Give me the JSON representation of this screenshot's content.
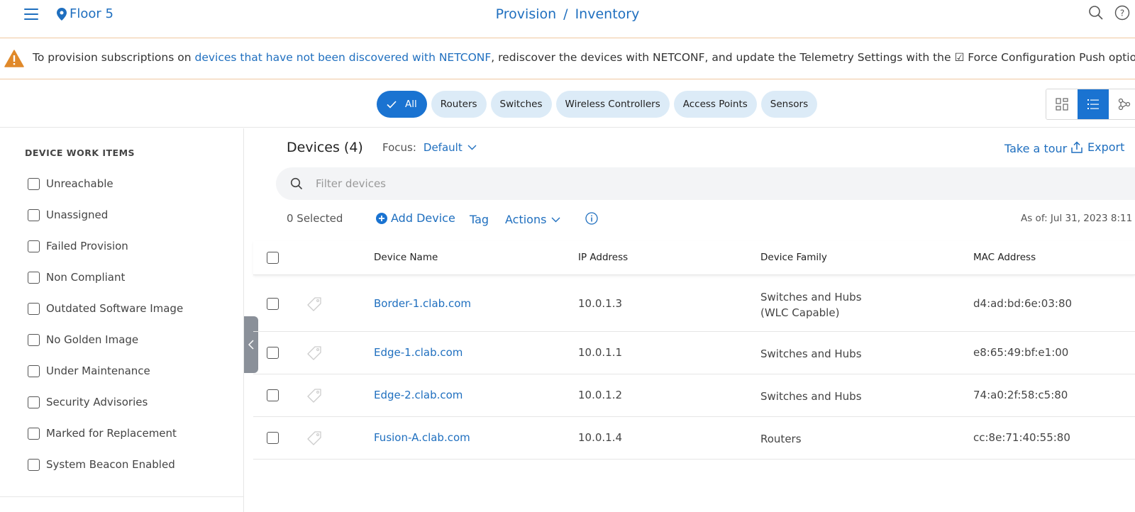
{
  "header": {
    "location": "Floor 5",
    "breadcrumb": {
      "section": "Provision",
      "separator": "/",
      "page": "Inventory"
    }
  },
  "banner": {
    "text_before": "To provision subscriptions on ",
    "link": "devices that have not been discovered with NETCONF",
    "text_after": ", rediscover the devices with NETCONF, and update the Telemetry Settings with the ☑ Force Configuration Push option"
  },
  "filters": [
    {
      "label": "All",
      "active": true
    },
    {
      "label": "Routers"
    },
    {
      "label": "Switches"
    },
    {
      "label": "Wireless Controllers"
    },
    {
      "label": "Access Points"
    },
    {
      "label": "Sensors"
    }
  ],
  "work_items": {
    "title": "DEVICE WORK ITEMS",
    "items": [
      "Unreachable",
      "Unassigned",
      "Failed Provision",
      "Non Compliant",
      "Outdated Software Image",
      "No Golden Image",
      "Under Maintenance",
      "Security Advisories",
      "Marked for Replacement",
      "System Beacon Enabled"
    ]
  },
  "devices": {
    "title": "Devices (4)",
    "focus_label": "Focus:",
    "focus_value": "Default",
    "take_tour": "Take a tour",
    "export": "Export",
    "search_placeholder": "Filter devices",
    "selected": "0 Selected",
    "add_device": "Add Device",
    "tag": "Tag",
    "actions": "Actions",
    "as_of": "As of: Jul 31, 2023 8:11"
  },
  "table": {
    "columns": [
      "Device Name",
      "IP Address",
      "Device Family",
      "MAC Address"
    ],
    "rows": [
      {
        "name": "Border-1.clab.com",
        "ip": "10.0.1.3",
        "family": "Switches and Hubs",
        "family2": "(WLC Capable)",
        "mac": "d4:ad:bd:6e:03:80"
      },
      {
        "name": "Edge-1.clab.com",
        "ip": "10.0.1.1",
        "family": "Switches and Hubs",
        "family2": "",
        "mac": "e8:65:49:bf:e1:00"
      },
      {
        "name": "Edge-2.clab.com",
        "ip": "10.0.1.2",
        "family": "Switches and Hubs",
        "family2": "",
        "mac": "74:a0:2f:58:c5:80"
      },
      {
        "name": "Fusion-A.clab.com",
        "ip": "10.0.1.4",
        "family": "Routers",
        "family2": "",
        "mac": "cc:8e:71:40:55:80"
      }
    ]
  },
  "colors": {
    "accent": "#1a73d1",
    "link": "#1f6fbf",
    "warning": "#e0892a",
    "pill": "#dcebf7"
  }
}
